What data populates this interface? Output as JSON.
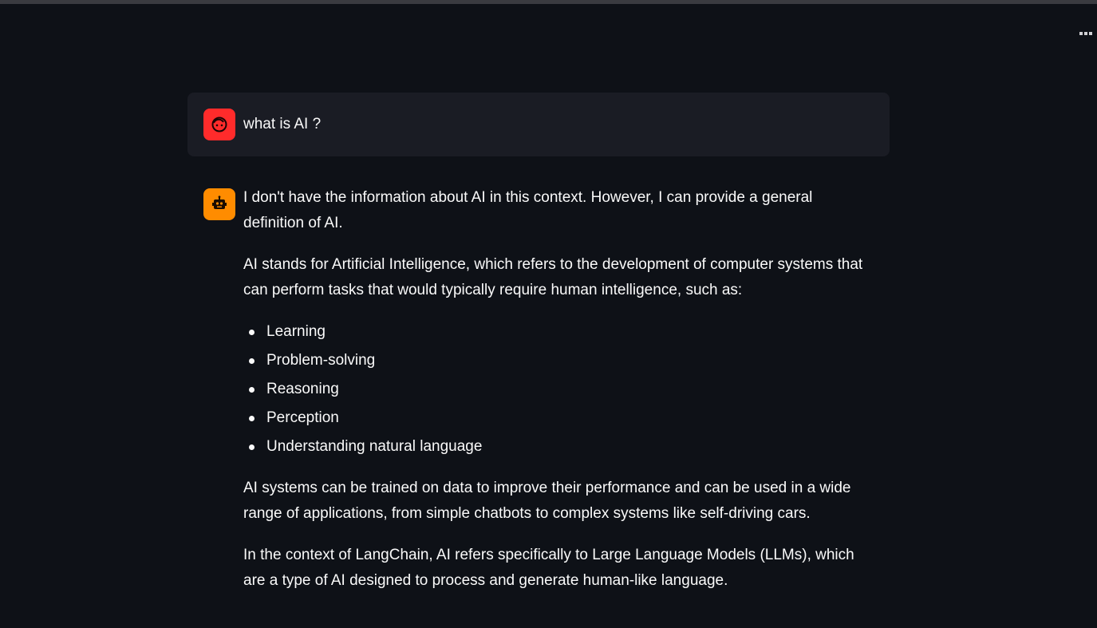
{
  "header": {
    "menu_icon": "more-horizontal-icon"
  },
  "colors": {
    "background": "#0e1117",
    "user_bubble": "#1a1c24",
    "user_avatar": "#ff2b2b",
    "assistant_avatar": "#ff8c00"
  },
  "messages": {
    "user": {
      "avatar_icon": "user-face-icon",
      "text": "what is AI ?"
    },
    "assistant": {
      "avatar_icon": "robot-icon",
      "paragraph_1": "I don't have the information about AI in this context. However, I can provide a general definition of AI.",
      "paragraph_2": "AI stands for Artificial Intelligence, which refers to the development of computer systems that can perform tasks that would typically require human intelligence, such as:",
      "list": [
        "Learning",
        "Problem-solving",
        "Reasoning",
        "Perception",
        "Understanding natural language"
      ],
      "paragraph_3": "AI systems can be trained on data to improve their performance and can be used in a wide range of applications, from simple chatbots to complex systems like self-driving cars.",
      "paragraph_4": "In the context of LangChain, AI refers specifically to Large Language Models (LLMs), which are a type of AI designed to process and generate human-like language."
    }
  }
}
